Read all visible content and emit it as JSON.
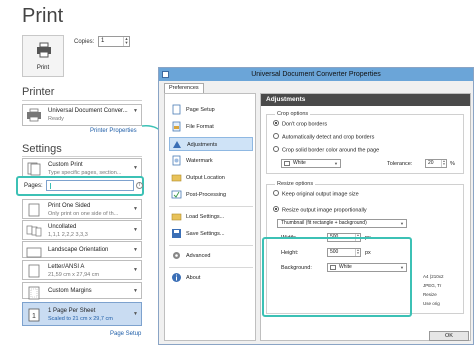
{
  "print": {
    "title": "Print",
    "print_button": "Print",
    "copies_label": "Copies:",
    "copies_value": "1"
  },
  "printer": {
    "heading": "Printer",
    "name": "Universal Document Conver...",
    "status": "Ready",
    "properties_link": "Printer Properties"
  },
  "settings": {
    "heading": "Settings",
    "custom_print": {
      "title": "Custom Print",
      "subtitle": "Type specific pages, section..."
    },
    "pages_label": "Pages:",
    "pages_value": "",
    "one_sided": {
      "title": "Print One Sided",
      "subtitle": "Only print on one side of th..."
    },
    "collated": {
      "title": "Uncollated",
      "subtitle": "1,1,1  2,2,2  3,3,3"
    },
    "orientation": {
      "title": "Landscape Orientation"
    },
    "paper": {
      "title": "Letter/ANSI A",
      "subtitle": "21,59 cm x 27,94 cm"
    },
    "margins": {
      "title": "Custom Margins"
    },
    "per_sheet": {
      "title": "1 Page Per Sheet",
      "subtitle": "Scaled to 21 cm x 29,7 cm"
    },
    "page_setup_link": "Page Setup"
  },
  "dialog": {
    "title": "Universal Document Converter Properties",
    "tab": "Preferences",
    "sidebar": [
      {
        "label": "Page Setup",
        "icon": "page-setup-icon"
      },
      {
        "label": "File Format",
        "icon": "file-format-icon"
      },
      {
        "label": "Adjustments",
        "icon": "adjustments-icon"
      },
      {
        "label": "Watermark",
        "icon": "watermark-icon"
      },
      {
        "label": "Output Location",
        "icon": "output-location-icon"
      },
      {
        "label": "Post-Processing",
        "icon": "post-processing-icon"
      },
      {
        "label": "Load Settings...",
        "icon": "load-settings-icon"
      },
      {
        "label": "Save Settings...",
        "icon": "save-settings-icon"
      },
      {
        "label": "Advanced",
        "icon": "advanced-icon"
      },
      {
        "label": "About",
        "icon": "about-icon"
      }
    ],
    "content_heading": "Adjustments",
    "crop": {
      "group_title": "Crop options",
      "opt1": "Don't crop borders",
      "opt2": "Automatically detect and crop borders",
      "opt3": "Crop solid border color around the page",
      "color_value": "White",
      "tolerance_label": "Tolerance:",
      "tolerance_value": "20",
      "tolerance_unit": "%"
    },
    "resize": {
      "group_title": "Resize options",
      "opt1": "Keep original output image size",
      "opt2": "Resize output image proportionally",
      "mode_value": "Thumbnail (fit rectangle + background)",
      "width_label": "Width:",
      "width_value": "500",
      "height_label": "Height:",
      "height_value": "500",
      "unit": "px",
      "background_label": "Background:",
      "background_value": "White"
    },
    "preview_lines": [
      "A4 (210x2",
      "JPEG, Tr",
      "Resize",
      "Use orig"
    ],
    "ok_button": "OK"
  },
  "colors": {
    "accent": "#3cc1b5",
    "titlebar": "#6ba5d8",
    "link": "#1f5ea8"
  }
}
